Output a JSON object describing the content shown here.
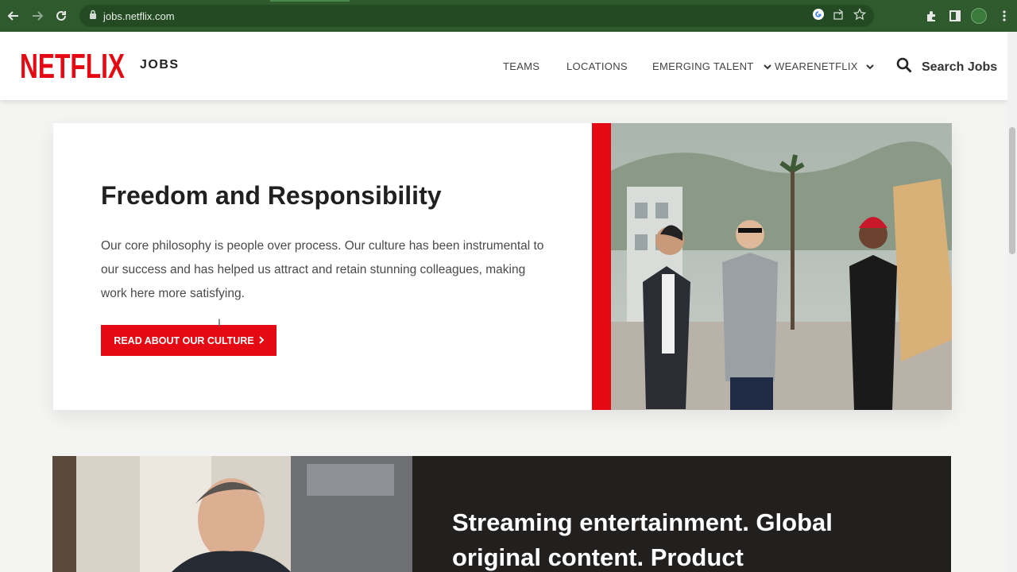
{
  "browser": {
    "url": "jobs.netflix.com"
  },
  "header": {
    "logo_text": "NETFLIX",
    "logo_suffix": "JOBS",
    "nav": [
      {
        "label": "TEAMS"
      },
      {
        "label": "LOCATIONS"
      },
      {
        "label": "EMERGING TALENT"
      },
      {
        "label": "WEARENETFLIX"
      }
    ],
    "search_label": "Search Jobs"
  },
  "culture": {
    "title": "Freedom and Responsibility",
    "body": "Our core philosophy is people over process. Our culture has been instrumental to our success and has helped us attract and retain stunning colleagues, making work here more satisfying.",
    "button_label": "READ ABOUT OUR CULTURE"
  },
  "streaming": {
    "title": "Streaming entertainment. Global original content. Product"
  },
  "colors": {
    "brand_red": "#e50914",
    "dark_panel": "#221f1f",
    "chrome_green": "#2e5a2e"
  }
}
